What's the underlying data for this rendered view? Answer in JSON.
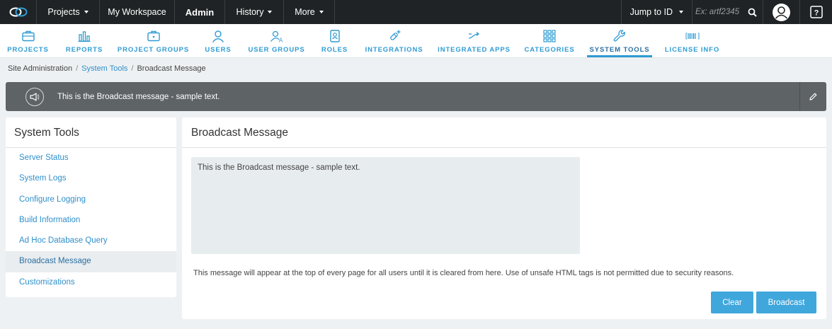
{
  "topnav": {
    "items": [
      {
        "label": "Projects",
        "dropdown": true
      },
      {
        "label": "My Workspace",
        "dropdown": false
      },
      {
        "label": "Admin",
        "dropdown": false,
        "active": true
      },
      {
        "label": "History",
        "dropdown": true
      },
      {
        "label": "More",
        "dropdown": true
      }
    ],
    "jump_label": "Jump to ID",
    "search_placeholder": "Ex: artf2345"
  },
  "adminnav": {
    "tabs": [
      {
        "label": "PROJECTS",
        "icon": "briefcase-icon"
      },
      {
        "label": "REPORTS",
        "icon": "bar-chart-icon"
      },
      {
        "label": "PROJECT GROUPS",
        "icon": "briefcase-group-icon"
      },
      {
        "label": "USERS",
        "icon": "user-icon"
      },
      {
        "label": "USER GROUPS",
        "icon": "user-group-icon"
      },
      {
        "label": "ROLES",
        "icon": "role-badge-icon"
      },
      {
        "label": "INTEGRATIONS",
        "icon": "plug-plus-icon"
      },
      {
        "label": "INTEGRATED APPS",
        "icon": "shuffle-icon"
      },
      {
        "label": "CATEGORIES",
        "icon": "grid-icon"
      },
      {
        "label": "SYSTEM TOOLS",
        "icon": "wrench-icon",
        "active": true
      },
      {
        "label": "LICENSE INFO",
        "icon": "barcode-icon"
      }
    ]
  },
  "breadcrumb": {
    "root": "Site Administration",
    "parent": "System Tools",
    "current": "Broadcast Message",
    "separator": "/"
  },
  "banner": {
    "text": "This is the Broadcast message - sample text."
  },
  "sidebar": {
    "title": "System Tools",
    "items": [
      {
        "label": "Server Status"
      },
      {
        "label": "System Logs"
      },
      {
        "label": "Configure Logging"
      },
      {
        "label": "Build Information"
      },
      {
        "label": "Ad Hoc Database Query"
      },
      {
        "label": "Broadcast Message",
        "active": true
      },
      {
        "label": "Customizations"
      }
    ]
  },
  "main": {
    "title": "Broadcast Message",
    "message_value": "This is the Broadcast message - sample text.",
    "help_text": "This message will appear at the top of every page for all users until it is cleared from here. Use of unsafe HTML tags is not permitted due to security reasons.",
    "clear_label": "Clear",
    "broadcast_label": "Broadcast"
  },
  "colors": {
    "topbar_bg": "#1f2325",
    "accent": "#2f9bd3",
    "banner_bg": "#5e6366",
    "button_bg": "#3fa7dc"
  }
}
